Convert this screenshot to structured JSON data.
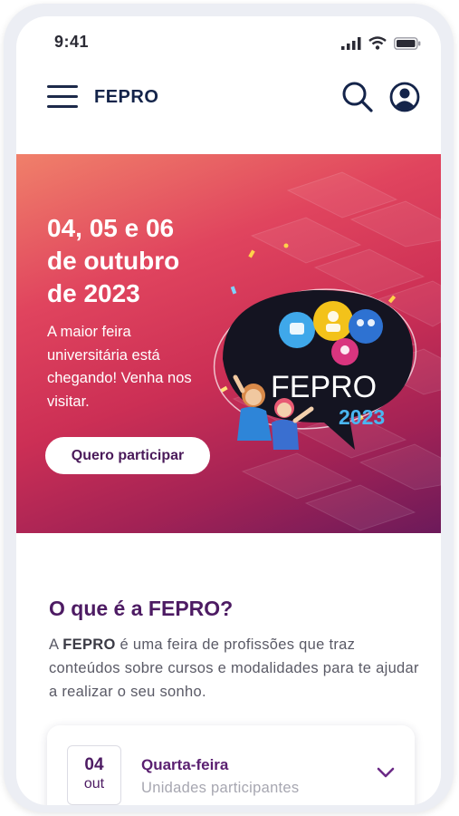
{
  "status_bar": {
    "time": "9:41"
  },
  "header": {
    "brand": "FEPRO"
  },
  "hero": {
    "date_lines": [
      "04, 05 e 06",
      "de outubro",
      "de 2023"
    ],
    "description": "A maior feira universitária está chegando! Venha nos visitar.",
    "cta_label": "Quero participar",
    "logo_title": "FEPRO",
    "logo_year": "2023"
  },
  "about": {
    "title": "O que é a FEPRO?",
    "text_prefix": "A ",
    "text_brand": "FEPRO",
    "text_rest": " é uma feira de profissões que traz conteúdos sobre cursos e modalidades para te ajudar a realizar o seu sonho."
  },
  "schedule": [
    {
      "day": "04",
      "month": "out",
      "weekday": "Quarta-feira",
      "subtitle": "Unidades participantes"
    }
  ],
  "colors": {
    "accent_purple": "#4d1b63",
    "navy": "#14244a",
    "hero_start": "#f0806a",
    "hero_end": "#6c1a5a"
  },
  "icons": [
    "menu-icon",
    "search-icon",
    "user-icon",
    "signal-icon",
    "wifi-icon",
    "battery-icon",
    "chevron-down-icon"
  ]
}
